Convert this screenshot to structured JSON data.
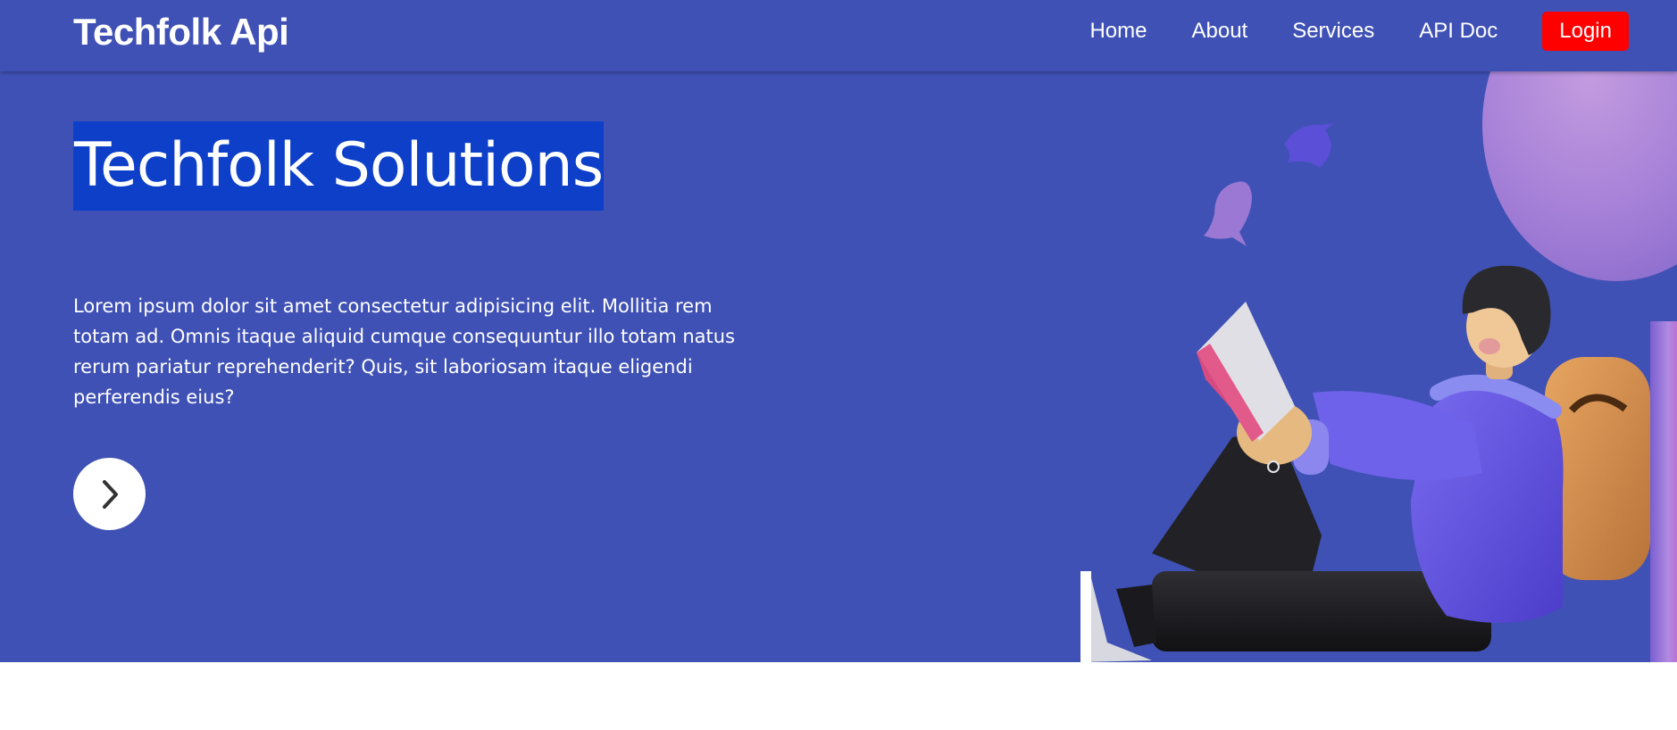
{
  "navbar": {
    "brand": "Techfolk Api",
    "links": [
      "Home",
      "About",
      "Services",
      "API Doc"
    ],
    "login_label": "Login"
  },
  "hero": {
    "title": "Techfolk Solutions",
    "description": "Lorem ipsum dolor sit amet consectetur adipisicing elit. Mollitia rem totam ad. Omnis itaque aliquid cumque consequuntur illo totam natus rerum pariatur reprehenderit? Quis, sit laboriosam itaque eligendi perferendis eius?",
    "next_icon": "chevron-right-icon"
  },
  "colors": {
    "primary": "#3f51b5",
    "title_highlight": "#0d3fc9",
    "login": "#ff0000",
    "text": "#ffffff"
  }
}
